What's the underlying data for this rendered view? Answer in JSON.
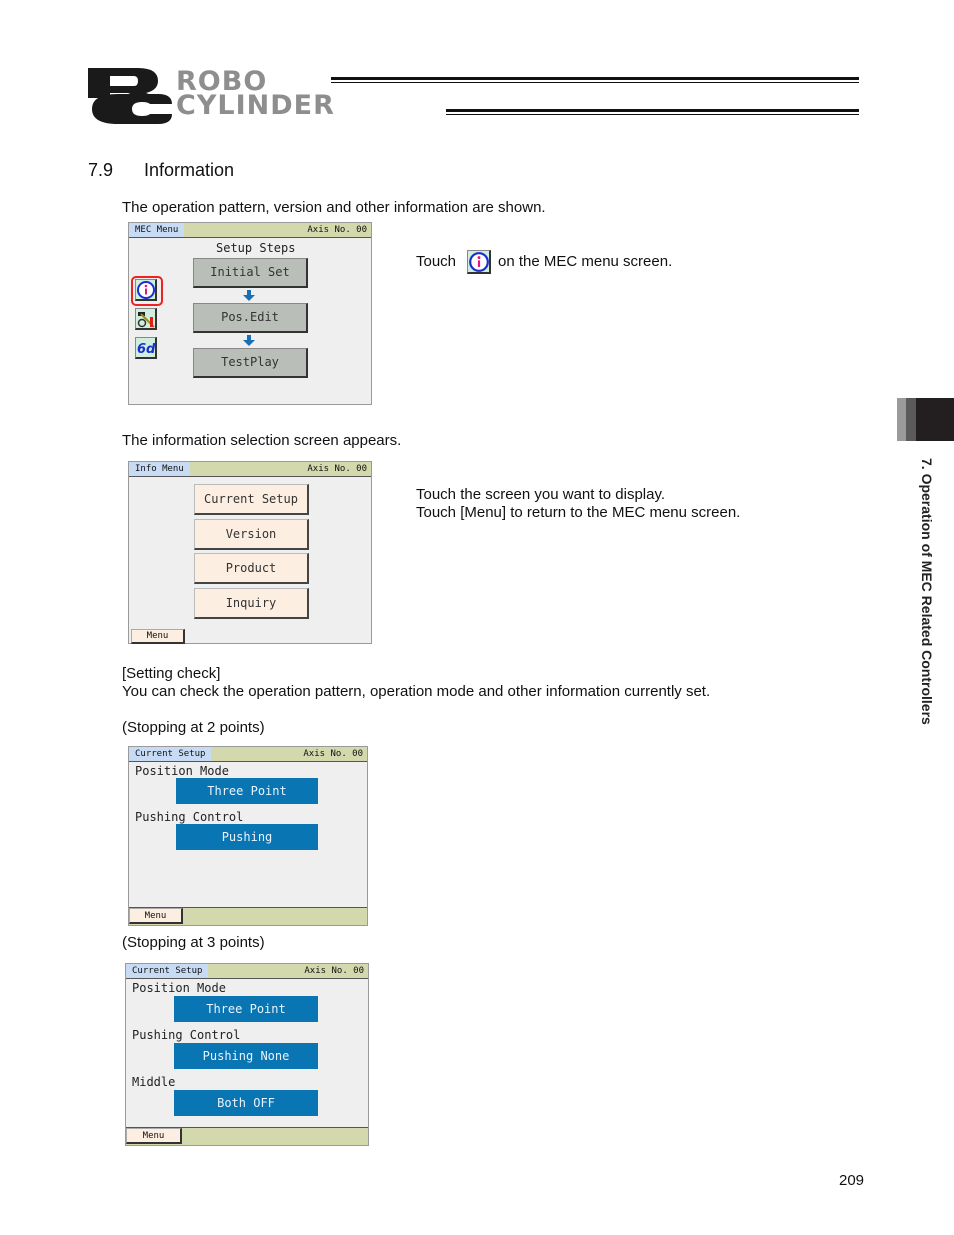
{
  "header": {
    "logo_line1": "ROBO",
    "logo_line2": "CYLINDER"
  },
  "section": {
    "number": "7.9",
    "title": "Information"
  },
  "intro_text": "The operation pattern, version and other information are shown.",
  "side_tab": {
    "label": "7. Operation of MEC Related Controllers"
  },
  "step1": {
    "instruction_prefix": "Touch",
    "instruction_suffix": "on the MEC menu screen.",
    "screen": {
      "title": "MEC Menu",
      "axis": "Axis No. 00",
      "heading": "Setup Steps",
      "buttons": [
        "Initial Set",
        "Pos.Edit",
        "TestPlay"
      ],
      "side_icons": [
        "info-icon",
        "tool-icon",
        "glasses-icon"
      ]
    }
  },
  "step2": {
    "caption": "The information selection screen appears.",
    "instruction_line1": "Touch the screen you want to display.",
    "instruction_line2": "Touch [Menu] to return to the MEC menu screen.",
    "screen": {
      "title": "Info Menu",
      "axis": "Axis No. 00",
      "buttons": [
        "Current Setup",
        "Version",
        "Product",
        "Inquiry"
      ],
      "menu_button": "Menu"
    }
  },
  "setting_check": {
    "heading": "[Setting check]",
    "description": "You can check the operation pattern, operation mode and other information currently set."
  },
  "two_points": {
    "caption": "(Stopping at 2 points)",
    "screen": {
      "title": "Current Setup",
      "axis": "Axis No. 00",
      "fields": [
        {
          "label": "Position Mode",
          "value": "Three Point"
        },
        {
          "label": "Pushing Control",
          "value": "Pushing"
        }
      ],
      "menu_button": "Menu"
    }
  },
  "three_points": {
    "caption": "(Stopping at 3 points)",
    "screen": {
      "title": "Current Setup",
      "axis": "Axis No. 00",
      "fields": [
        {
          "label": "Position Mode",
          "value": "Three Point"
        },
        {
          "label": "Pushing Control",
          "value": "Pushing None"
        },
        {
          "label": "Middle",
          "value": "Both OFF"
        }
      ],
      "menu_button": "Menu"
    }
  },
  "page_number": "209"
}
